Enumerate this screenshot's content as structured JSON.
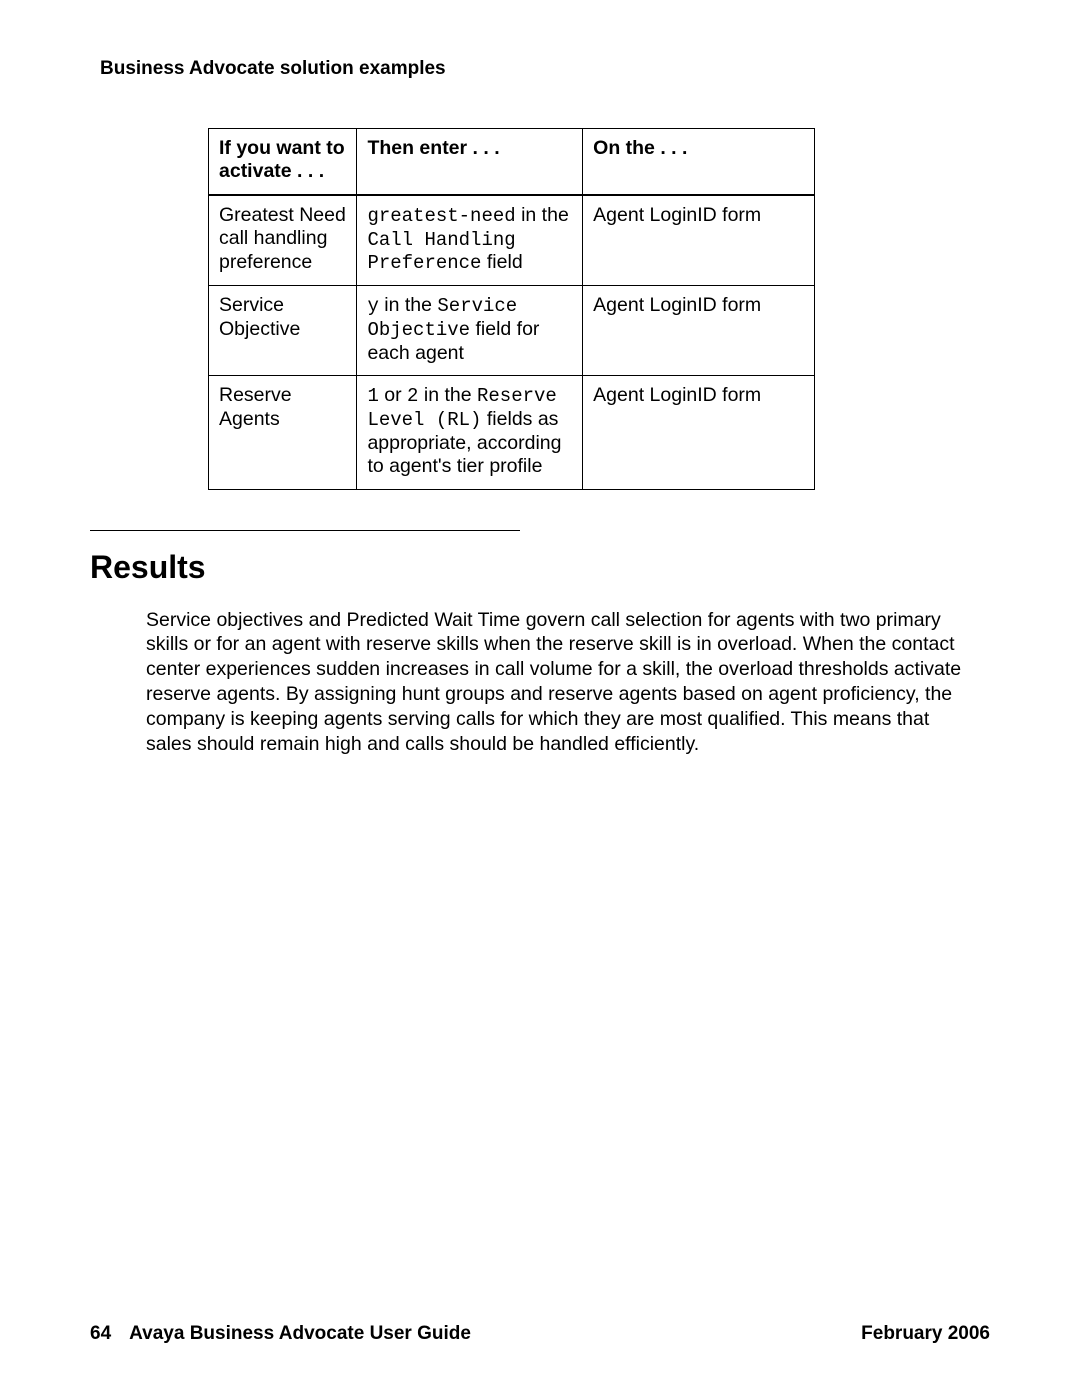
{
  "header": {
    "running_title": "Business Advocate solution examples"
  },
  "table": {
    "headers": {
      "col1": "If you want to activate . . .",
      "col2": "Then enter . . .",
      "col3": "On the . . ."
    },
    "rows": [
      {
        "activate": "Greatest Need call handling preference",
        "enter_parts": {
          "p1_mono": "greatest-need",
          "p2": " in the ",
          "p3_mono": "Call Handling Preference",
          "p4": " field"
        },
        "on_the": "Agent LoginID form"
      },
      {
        "activate": "Service Objective",
        "enter_parts": {
          "p1_mono": "y",
          "p2": " in the ",
          "p3_mono": "Service Objective",
          "p4": " field for each agent"
        },
        "on_the": "Agent LoginID form"
      },
      {
        "activate": "Reserve Agents",
        "enter_parts": {
          "p1_mono": "1",
          "p2": " or ",
          "p3_mono": "2",
          "p4": " in the ",
          "p5_mono": "Reserve Level (RL)",
          "p6": " fields as appropriate, according to agent's tier profile"
        },
        "on_the": "Agent LoginID form"
      }
    ]
  },
  "section": {
    "heading": "Results",
    "body": "Service objectives and Predicted Wait Time govern call selection for agents with two primary skills or for an agent with reserve skills when the reserve skill is in overload. When the contact center experiences sudden increases in call volume for a skill, the overload thresholds activate reserve agents. By assigning hunt groups and reserve agents based on agent proficiency, the company is keeping agents serving calls for which they are most qualified. This means that sales should remain high and calls should be handled efficiently."
  },
  "footer": {
    "page_number": "64",
    "doc_title": "Avaya Business Advocate User Guide",
    "date": "February 2006"
  }
}
